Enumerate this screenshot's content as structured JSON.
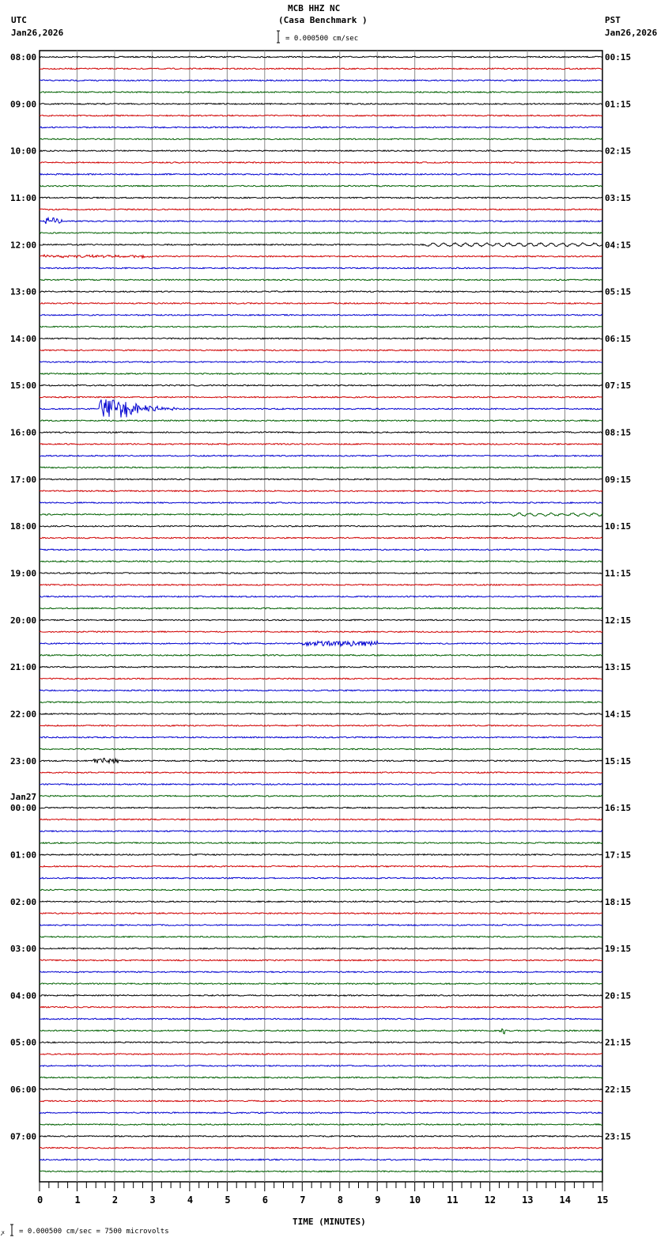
{
  "header": {
    "station": "MCB HHZ NC",
    "site": "(Casa Benchmark )",
    "left_tz": "UTC",
    "left_date": "Jan26,2026",
    "right_tz": "PST",
    "right_date": "Jan26,2026",
    "scale": "= 0.000500 cm/sec"
  },
  "footer": {
    "scale": "= 0.000500 cm/sec =    7500 microvolts"
  },
  "chart_data": {
    "type": "line",
    "title": "MCB HHZ NC (Casa Benchmark )",
    "xlabel": "TIME (MINUTES)",
    "xlim": [
      0,
      15
    ],
    "xticks": [
      "0",
      "1",
      "2",
      "3",
      "4",
      "5",
      "6",
      "7",
      "8",
      "9",
      "10",
      "11",
      "12",
      "13",
      "14",
      "15"
    ],
    "traces_per_hour": 4,
    "trace_count": 96,
    "trace_colors": [
      "#000000",
      "#d00000",
      "#0000d0",
      "#006000"
    ],
    "left_labels": [
      "08:00",
      "09:00",
      "10:00",
      "11:00",
      "12:00",
      "13:00",
      "14:00",
      "15:00",
      "16:00",
      "17:00",
      "18:00",
      "19:00",
      "20:00",
      "21:00",
      "22:00",
      "23:00",
      "00:00",
      "01:00",
      "02:00",
      "03:00",
      "04:00",
      "05:00",
      "06:00",
      "07:00"
    ],
    "left_date_change": {
      "hour_index": 16,
      "label": "Jan27"
    },
    "right_labels": [
      "00:15",
      "01:15",
      "02:15",
      "03:15",
      "04:15",
      "05:15",
      "06:15",
      "07:15",
      "08:15",
      "09:15",
      "10:15",
      "11:15",
      "12:15",
      "13:15",
      "14:15",
      "15:15",
      "16:15",
      "17:15",
      "18:15",
      "19:15",
      "20:15",
      "21:15",
      "22:15",
      "23:15"
    ],
    "events": [
      {
        "trace": 14,
        "start": 0.15,
        "end": 0.6,
        "amp": 4,
        "kind": "burst"
      },
      {
        "trace": 16,
        "start": 10.3,
        "end": 15,
        "amp": 3,
        "kind": "wave"
      },
      {
        "trace": 17,
        "start": 0,
        "end": 3,
        "amp": 1.5,
        "kind": "burst"
      },
      {
        "trace": 30,
        "start": 1.6,
        "end": 4.5,
        "amp": 12,
        "kind": "quake"
      },
      {
        "trace": 39,
        "start": 12.5,
        "end": 15,
        "amp": 2.5,
        "kind": "wave"
      },
      {
        "trace": 50,
        "start": 7,
        "end": 9,
        "amp": 3,
        "kind": "burst"
      },
      {
        "trace": 60,
        "start": 1.4,
        "end": 2.1,
        "amp": 3,
        "kind": "burst"
      },
      {
        "trace": 83,
        "start": 12.25,
        "end": 12.4,
        "amp": 4,
        "kind": "burst"
      }
    ]
  }
}
